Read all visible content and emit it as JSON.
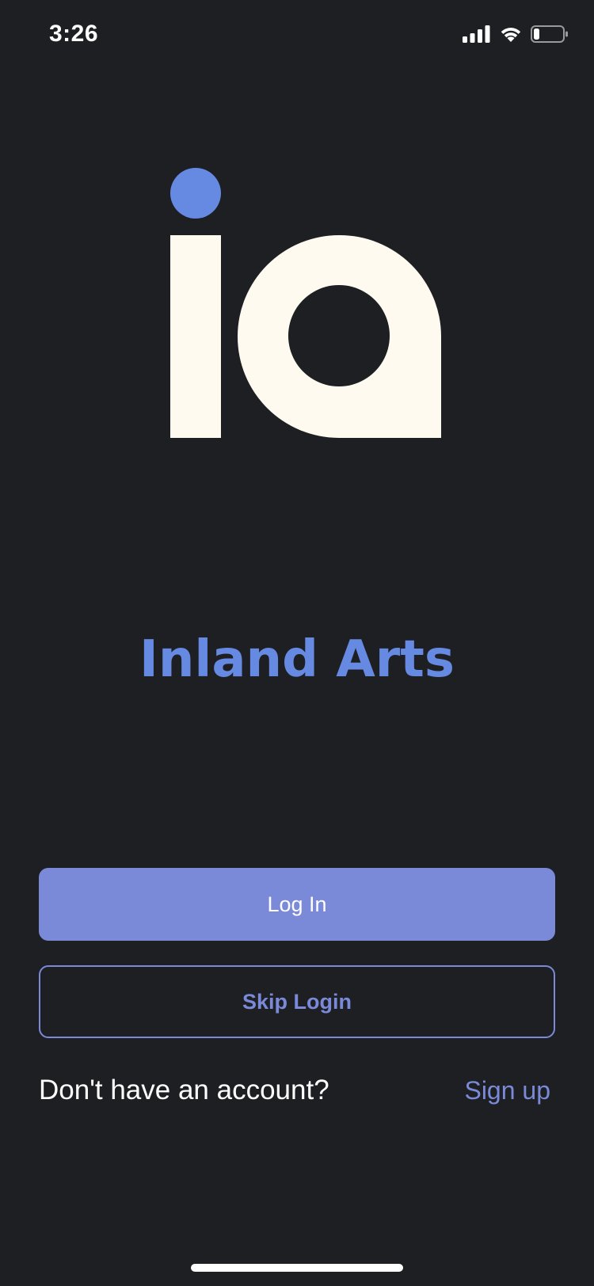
{
  "status_bar": {
    "time": "3:26",
    "icons": [
      "cellular-signal-icon",
      "wifi-icon",
      "battery-icon"
    ],
    "battery_level": 0.2
  },
  "brand": {
    "logo_mark": "ia",
    "name": "Inland Arts",
    "logo_color": "#fffaf0",
    "accent_color": "#6689e2"
  },
  "actions": {
    "login_label": "Log In",
    "skip_label": "Skip Login",
    "primary_color": "#7b8ad8"
  },
  "signup": {
    "prompt": "Don't have an account?",
    "link_label": "Sign up"
  },
  "colors": {
    "background": "#1e1f23"
  }
}
